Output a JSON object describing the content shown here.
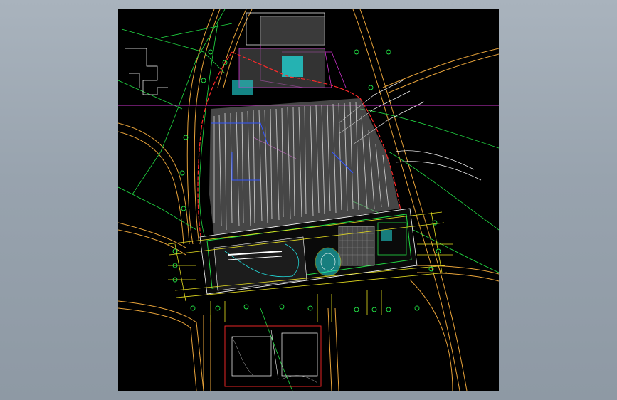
{
  "drawing": {
    "background": "#000000",
    "colors": {
      "road": "#e8a33a",
      "boundary": "#ff2a2a",
      "green": "#22dd44",
      "magenta": "#cc33cc",
      "cyan": "#22dddd",
      "blue": "#3355ff",
      "white": "#ffffff",
      "hatch": "#b8b8b8",
      "yellow": "#e8e020"
    },
    "labels": []
  }
}
